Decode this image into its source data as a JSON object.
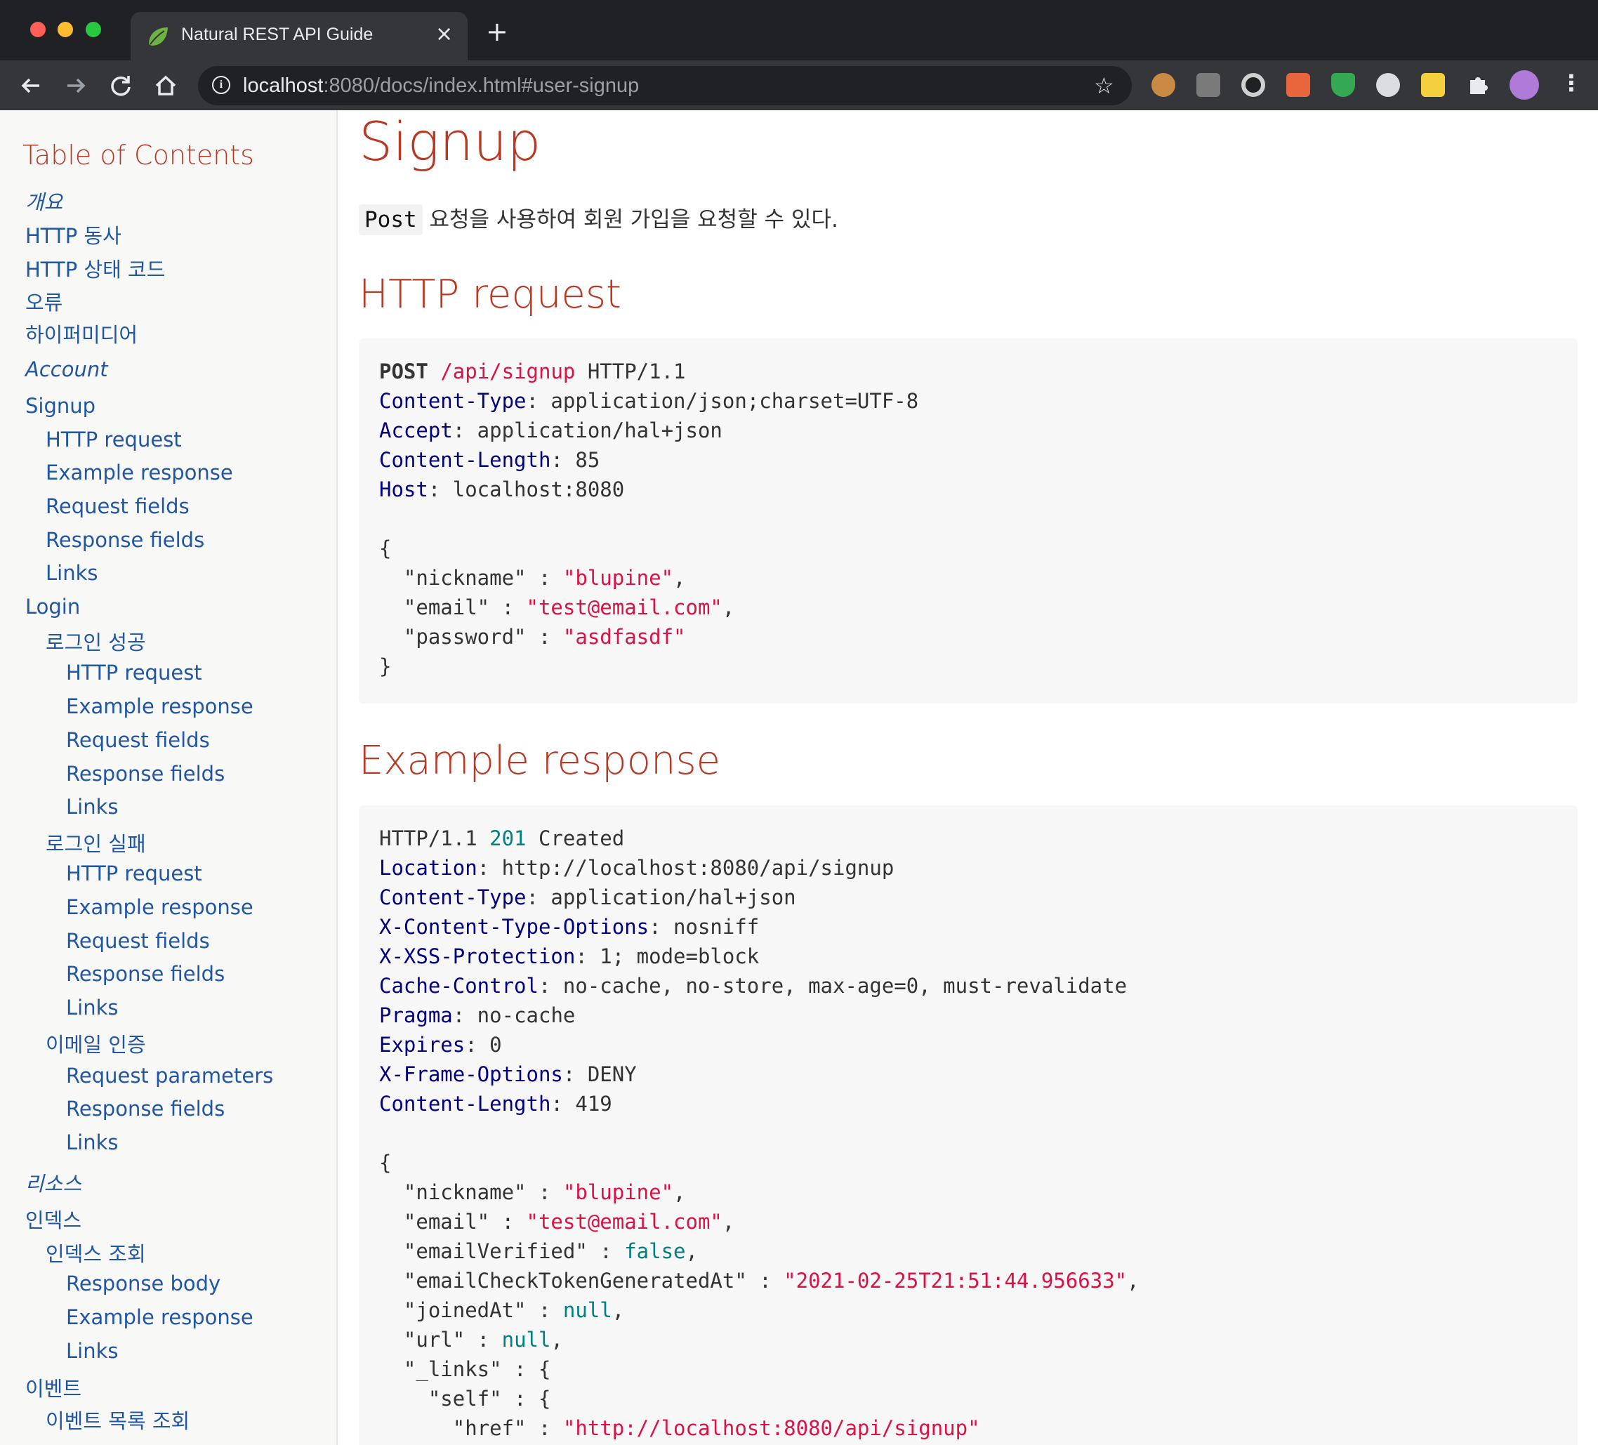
{
  "browser": {
    "tab_title": "Natural REST API Guide",
    "tab_close": "×",
    "new_tab": "+",
    "url_host": "localhost",
    "url_path": ":8080/docs/index.html#user-signup",
    "icons": [
      "back-icon",
      "forward-icon",
      "reload-icon",
      "home-icon",
      "info-icon",
      "star-icon",
      "cookie-extension-icon",
      "instapaper-extension-icon",
      "circle-extension-icon",
      "ex-extension-icon",
      "shield-extension-icon",
      "refresh-extension-icon",
      "k-extension-icon",
      "puzzle-extension-icon",
      "profile-avatar-icon",
      "menu-icon"
    ]
  },
  "toc": {
    "title": "Table of Contents",
    "items": [
      {
        "label": "개요"
      },
      {
        "label": "HTTP 동사"
      },
      {
        "label": "HTTP 상태 코드"
      },
      {
        "label": "오류"
      },
      {
        "label": "하이퍼미디어"
      },
      {
        "label": "Account"
      },
      {
        "label": "Signup"
      },
      {
        "label": "HTTP request"
      },
      {
        "label": "Example response"
      },
      {
        "label": "Request fields"
      },
      {
        "label": "Response fields"
      },
      {
        "label": "Links"
      },
      {
        "label": "Login"
      },
      {
        "label": "로그인 성공"
      },
      {
        "label": "HTTP request"
      },
      {
        "label": "Example response"
      },
      {
        "label": "Request fields"
      },
      {
        "label": "Response fields"
      },
      {
        "label": "Links"
      },
      {
        "label": "로그인 실패"
      },
      {
        "label": "HTTP request"
      },
      {
        "label": "Example response"
      },
      {
        "label": "Request fields"
      },
      {
        "label": "Response fields"
      },
      {
        "label": "Links"
      },
      {
        "label": "이메일 인증"
      },
      {
        "label": "Request parameters"
      },
      {
        "label": "Response fields"
      },
      {
        "label": "Links"
      },
      {
        "label": "리소스"
      },
      {
        "label": "인덱스"
      },
      {
        "label": "인덱스 조회"
      },
      {
        "label": "Response body"
      },
      {
        "label": "Example response"
      },
      {
        "label": "Links"
      },
      {
        "label": "이벤트"
      },
      {
        "label": "이벤트 목록 조회"
      }
    ]
  },
  "content": {
    "title": "Signup",
    "intro_code": "Post",
    "intro_text": " 요청을 사용하여 회원 가입을 요청할 수 있다.",
    "section_request": "HTTP request",
    "section_response": "Example response",
    "request_lines": [
      [
        {
          "t": "POST",
          "c": "b"
        },
        {
          "t": " "
        },
        {
          "t": "/api/signup",
          "c": "s"
        },
        {
          "t": " HTTP/1.1"
        }
      ],
      [
        {
          "t": "Content-Type",
          "c": "k"
        },
        {
          "t": ": application/json;charset=UTF-8"
        }
      ],
      [
        {
          "t": "Accept",
          "c": "k"
        },
        {
          "t": ": application/hal+json"
        }
      ],
      [
        {
          "t": "Content-Length",
          "c": "k"
        },
        {
          "t": ": 85"
        }
      ],
      [
        {
          "t": "Host",
          "c": "k"
        },
        {
          "t": ": localhost:8080"
        }
      ],
      [],
      [
        {
          "t": "{"
        }
      ],
      [
        {
          "t": "  \"nickname\" : "
        },
        {
          "t": "\"blupine\"",
          "c": "s"
        },
        {
          "t": ","
        }
      ],
      [
        {
          "t": "  \"email\" : "
        },
        {
          "t": "\"test@email.com\"",
          "c": "s"
        },
        {
          "t": ","
        }
      ],
      [
        {
          "t": "  \"password\" : "
        },
        {
          "t": "\"asdfasdf\"",
          "c": "s"
        }
      ],
      [
        {
          "t": "}"
        }
      ]
    ],
    "response_lines": [
      [
        {
          "t": "HTTP/1.1 "
        },
        {
          "t": "201",
          "c": "m"
        },
        {
          "t": " Created"
        }
      ],
      [
        {
          "t": "Location",
          "c": "k"
        },
        {
          "t": ": http://localhost:8080/api/signup"
        }
      ],
      [
        {
          "t": "Content-Type",
          "c": "k"
        },
        {
          "t": ": application/hal+json"
        }
      ],
      [
        {
          "t": "X-Content-Type-Options",
          "c": "k"
        },
        {
          "t": ": nosniff"
        }
      ],
      [
        {
          "t": "X-XSS-Protection",
          "c": "k"
        },
        {
          "t": ": 1; mode=block"
        }
      ],
      [
        {
          "t": "Cache-Control",
          "c": "k"
        },
        {
          "t": ": no-cache, no-store, max-age=0, must-revalidate"
        }
      ],
      [
        {
          "t": "Pragma",
          "c": "k"
        },
        {
          "t": ": no-cache"
        }
      ],
      [
        {
          "t": "Expires",
          "c": "k"
        },
        {
          "t": ": 0"
        }
      ],
      [
        {
          "t": "X-Frame-Options",
          "c": "k"
        },
        {
          "t": ": DENY"
        }
      ],
      [
        {
          "t": "Content-Length",
          "c": "k"
        },
        {
          "t": ": 419"
        }
      ],
      [],
      [
        {
          "t": "{"
        }
      ],
      [
        {
          "t": "  \"nickname\" : "
        },
        {
          "t": "\"blupine\"",
          "c": "s"
        },
        {
          "t": ","
        }
      ],
      [
        {
          "t": "  \"email\" : "
        },
        {
          "t": "\"test@email.com\"",
          "c": "s"
        },
        {
          "t": ","
        }
      ],
      [
        {
          "t": "  \"emailVerified\" : "
        },
        {
          "t": "false",
          "c": "m"
        },
        {
          "t": ","
        }
      ],
      [
        {
          "t": "  \"emailCheckTokenGeneratedAt\" : "
        },
        {
          "t": "\"2021-02-25T21:51:44.956633\"",
          "c": "s"
        },
        {
          "t": ","
        }
      ],
      [
        {
          "t": "  \"joinedAt\" : "
        },
        {
          "t": "null",
          "c": "m"
        },
        {
          "t": ","
        }
      ],
      [
        {
          "t": "  \"url\" : "
        },
        {
          "t": "null",
          "c": "m"
        },
        {
          "t": ","
        }
      ],
      [
        {
          "t": "  \"_links\" : {"
        }
      ],
      [
        {
          "t": "    \"self\" : {"
        }
      ],
      [
        {
          "t": "      \"href\" : "
        },
        {
          "t": "\"http://localhost:8080/api/signup\"",
          "c": "s"
        }
      ]
    ]
  },
  "colors": {
    "heading": "#ba3925",
    "link": "#2156a5",
    "code_key": "#000080",
    "code_string": "#dd1144",
    "code_literal": "#008080"
  }
}
